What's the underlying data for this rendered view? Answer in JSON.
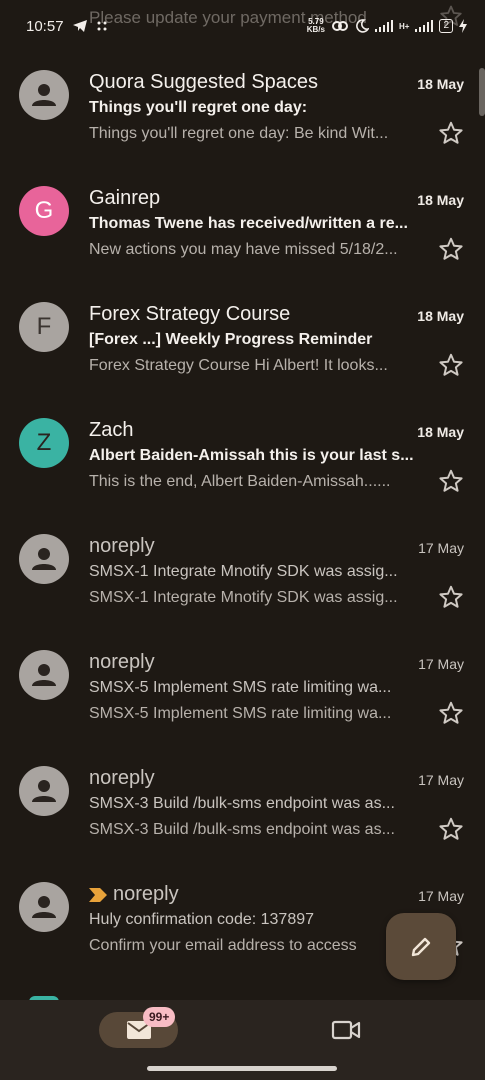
{
  "status_bar": {
    "time": "10:57",
    "net_speed_value": "5.79",
    "net_speed_unit": "KB/s",
    "network_type": "H+",
    "battery": "2"
  },
  "ghost_row": {
    "snippet": "Please update your payment method"
  },
  "emails": [
    {
      "sender": "Quora Suggested Spaces",
      "date": "18 May",
      "subject": "Things you'll regret one day:",
      "snippet": "Things you'll regret one day: Be kind Wit...",
      "unread": true,
      "avatar": "person",
      "important": false
    },
    {
      "sender": "Gainrep",
      "date": "18 May",
      "subject": "Thomas Twene has received/written a re...",
      "snippet": "New actions you may have missed 5/18/2...",
      "unread": true,
      "avatar": "G",
      "important": false
    },
    {
      "sender": "Forex Strategy Course",
      "date": "18 May",
      "subject": "[Forex ...] Weekly Progress Reminder",
      "snippet": "Forex Strategy Course Hi Albert! It looks...",
      "unread": true,
      "avatar": "F",
      "important": false
    },
    {
      "sender": "Zach",
      "date": "18 May",
      "subject": "Albert Baiden-Amissah this is your last s...",
      "snippet": "This is the end, Albert Baiden-Amissah......",
      "unread": true,
      "avatar": "Z",
      "important": false
    },
    {
      "sender": "noreply",
      "date": "17 May",
      "subject": "SMSX-1 Integrate Mnotify SDK was assig...",
      "snippet": "SMSX-1 Integrate Mnotify SDK was assig...",
      "unread": false,
      "avatar": "person",
      "important": false
    },
    {
      "sender": "noreply",
      "date": "17 May",
      "subject": "SMSX-5 Implement SMS rate limiting wa...",
      "snippet": "SMSX-5 Implement SMS rate limiting wa...",
      "unread": false,
      "avatar": "person",
      "important": false
    },
    {
      "sender": "noreply",
      "date": "17 May",
      "subject": "SMSX-3 Build /bulk-sms endpoint was as...",
      "snippet": "SMSX-3 Build /bulk-sms endpoint was as...",
      "unread": false,
      "avatar": "person",
      "important": false
    },
    {
      "sender": "noreply",
      "date": "17 May",
      "subject": "Huly confirmation code: 137897",
      "snippet": "Confirm your email address to access",
      "unread": false,
      "avatar": "person",
      "important": true
    }
  ],
  "bottom_nav": {
    "mail_badge": "99+",
    "mail_icon": "mail-icon",
    "meet_icon": "video-camera-icon"
  },
  "fab": {
    "icon": "pencil-icon"
  },
  "colors": {
    "background": "#1e1914",
    "nav_background": "#2a241f",
    "fab": "#5b4a39",
    "badge": "#f8bcc4",
    "avatar_g": "#e8649a",
    "avatar_z": "#3ab3a3",
    "avatar_grey": "#a9a4a0",
    "importance": "#e8a23a"
  }
}
